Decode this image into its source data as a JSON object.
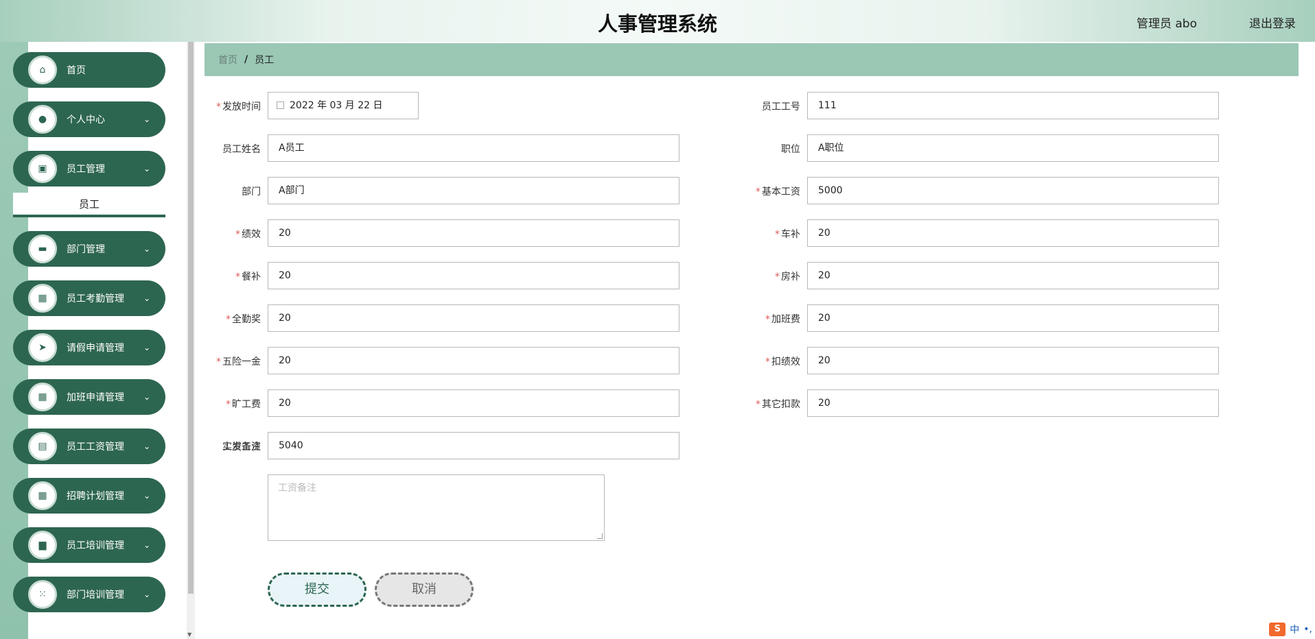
{
  "header": {
    "title": "人事管理系统",
    "user": "管理员 abo",
    "logout": "退出登录"
  },
  "sidebar": {
    "items": [
      {
        "label": "首页",
        "icon": "home-icon",
        "has_children": false
      },
      {
        "label": "个人中心",
        "icon": "user-icon",
        "has_children": true
      },
      {
        "label": "员工管理",
        "icon": "briefcase-icon",
        "has_children": true
      },
      {
        "label": "部门管理",
        "icon": "chat-icon",
        "has_children": true
      },
      {
        "label": "员工考勤管理",
        "icon": "grid-icon",
        "has_children": true
      },
      {
        "label": "请假申请管理",
        "icon": "send-icon",
        "has_children": true
      },
      {
        "label": "加班申请管理",
        "icon": "grid-icon",
        "has_children": true
      },
      {
        "label": "员工工资管理",
        "icon": "case-icon",
        "has_children": true
      },
      {
        "label": "招聘计划管理",
        "icon": "grid-icon",
        "has_children": true
      },
      {
        "label": "员工培训管理",
        "icon": "printer-icon",
        "has_children": true
      },
      {
        "label": "部门培训管理",
        "icon": "apps-icon",
        "has_children": true
      }
    ],
    "submenu_active": "员工"
  },
  "breadcrumb": {
    "home": "首页",
    "separator": "/",
    "current": "员工"
  },
  "form": {
    "left": [
      {
        "label": "发放时间",
        "required": true,
        "value": "2022 年 03 月 22 日",
        "type": "date"
      },
      {
        "label": "员工姓名",
        "required": false,
        "value": "A员工"
      },
      {
        "label": "部门",
        "required": false,
        "value": "A部门"
      },
      {
        "label": "绩效",
        "required": true,
        "value": "20"
      },
      {
        "label": "餐补",
        "required": true,
        "value": "20"
      },
      {
        "label": "全勤奖",
        "required": true,
        "value": "20"
      },
      {
        "label": "五险一金",
        "required": true,
        "value": "20"
      },
      {
        "label": "旷工费",
        "required": true,
        "value": "20"
      },
      {
        "label": "实发工资",
        "required": false,
        "value": "5040"
      }
    ],
    "right": [
      {
        "label": "员工工号",
        "required": false,
        "value": "111"
      },
      {
        "label": "职位",
        "required": false,
        "value": "A职位"
      },
      {
        "label": "基本工资",
        "required": true,
        "value": "5000"
      },
      {
        "label": "车补",
        "required": true,
        "value": "20"
      },
      {
        "label": "房补",
        "required": true,
        "value": "20"
      },
      {
        "label": "加班费",
        "required": true,
        "value": "20"
      },
      {
        "label": "扣绩效",
        "required": true,
        "value": "20"
      },
      {
        "label": "其它扣款",
        "required": true,
        "value": "20"
      }
    ],
    "remark": {
      "label": "工资备注",
      "placeholder": "工资备注",
      "value": ""
    },
    "required_mark": "*",
    "submit": "提交",
    "cancel": "取消"
  },
  "ime": {
    "lang": "中",
    "punct": "•,"
  },
  "colors": {
    "accent": "#2d6650",
    "breadcrumb_bg": "#9ac8b5",
    "required": "#e15a5a"
  }
}
